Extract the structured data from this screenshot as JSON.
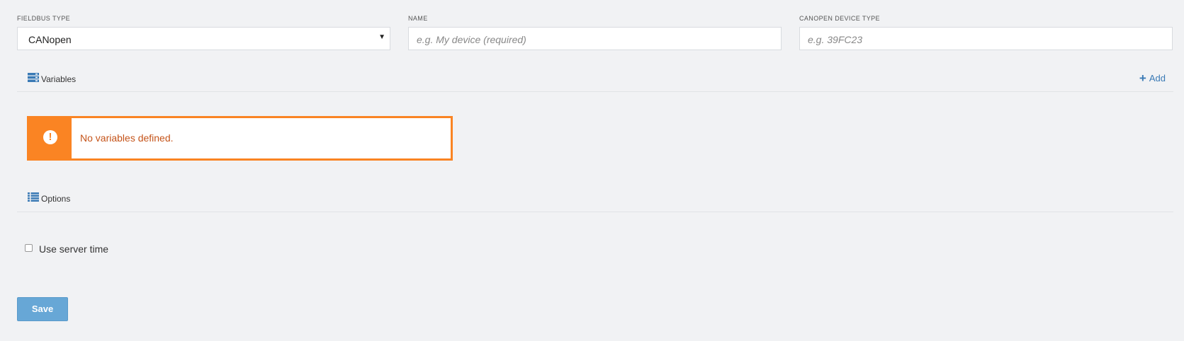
{
  "form": {
    "fieldbus_type": {
      "label": "FIELDBUS TYPE",
      "value": "CANopen"
    },
    "name": {
      "label": "NAME",
      "placeholder": "e.g. My device (required)"
    },
    "device_type": {
      "label": "CANOPEN DEVICE TYPE",
      "placeholder": "e.g. 39FC23"
    }
  },
  "variables": {
    "title": "Variables",
    "add_label": "Add",
    "icon": "server-stack-icon",
    "alert_text": "No variables defined.",
    "alert_icon": "exclamation-icon"
  },
  "options": {
    "title": "Options",
    "icon": "list-icon",
    "use_server_time_label": "Use server time",
    "use_server_time_checked": false
  },
  "actions": {
    "save_label": "Save"
  },
  "colors": {
    "background": "#f1f2f4",
    "warning": "#fa8423",
    "warning_text": "#c5541a",
    "link": "#3a7ab5",
    "primary_button": "#67a7d6"
  }
}
